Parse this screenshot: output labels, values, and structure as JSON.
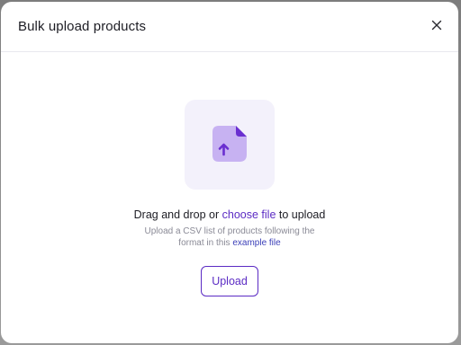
{
  "modal": {
    "title": "Bulk upload products",
    "close_icon": "close-icon"
  },
  "dropzone": {
    "icon": "file-upload-icon",
    "drag_prefix": "Drag and drop or ",
    "choose_file_link": "choose file",
    "drag_suffix": " to upload",
    "hint_line1": "Upload a CSV list of products following the",
    "hint_line2_prefix": "format in this ",
    "example_file_link": "example file",
    "upload_button": "Upload"
  },
  "colors": {
    "accent": "#5b2bc4",
    "icon_light": "#c7b2f2",
    "icon_dark": "#6a2fd0",
    "tile_bg": "#f3f1fb"
  }
}
